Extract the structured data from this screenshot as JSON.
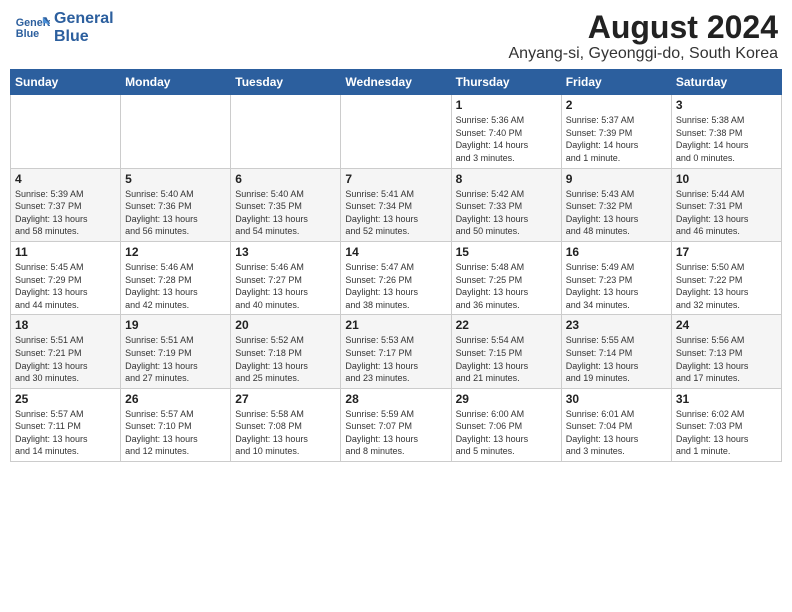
{
  "logo": {
    "line1": "General",
    "line2": "Blue"
  },
  "title": "August 2024",
  "subtitle": "Anyang-si, Gyeonggi-do, South Korea",
  "days_of_week": [
    "Sunday",
    "Monday",
    "Tuesday",
    "Wednesday",
    "Thursday",
    "Friday",
    "Saturday"
  ],
  "weeks": [
    [
      {
        "day": "",
        "info": ""
      },
      {
        "day": "",
        "info": ""
      },
      {
        "day": "",
        "info": ""
      },
      {
        "day": "",
        "info": ""
      },
      {
        "day": "1",
        "info": "Sunrise: 5:36 AM\nSunset: 7:40 PM\nDaylight: 14 hours\nand 3 minutes."
      },
      {
        "day": "2",
        "info": "Sunrise: 5:37 AM\nSunset: 7:39 PM\nDaylight: 14 hours\nand 1 minute."
      },
      {
        "day": "3",
        "info": "Sunrise: 5:38 AM\nSunset: 7:38 PM\nDaylight: 14 hours\nand 0 minutes."
      }
    ],
    [
      {
        "day": "4",
        "info": "Sunrise: 5:39 AM\nSunset: 7:37 PM\nDaylight: 13 hours\nand 58 minutes."
      },
      {
        "day": "5",
        "info": "Sunrise: 5:40 AM\nSunset: 7:36 PM\nDaylight: 13 hours\nand 56 minutes."
      },
      {
        "day": "6",
        "info": "Sunrise: 5:40 AM\nSunset: 7:35 PM\nDaylight: 13 hours\nand 54 minutes."
      },
      {
        "day": "7",
        "info": "Sunrise: 5:41 AM\nSunset: 7:34 PM\nDaylight: 13 hours\nand 52 minutes."
      },
      {
        "day": "8",
        "info": "Sunrise: 5:42 AM\nSunset: 7:33 PM\nDaylight: 13 hours\nand 50 minutes."
      },
      {
        "day": "9",
        "info": "Sunrise: 5:43 AM\nSunset: 7:32 PM\nDaylight: 13 hours\nand 48 minutes."
      },
      {
        "day": "10",
        "info": "Sunrise: 5:44 AM\nSunset: 7:31 PM\nDaylight: 13 hours\nand 46 minutes."
      }
    ],
    [
      {
        "day": "11",
        "info": "Sunrise: 5:45 AM\nSunset: 7:29 PM\nDaylight: 13 hours\nand 44 minutes."
      },
      {
        "day": "12",
        "info": "Sunrise: 5:46 AM\nSunset: 7:28 PM\nDaylight: 13 hours\nand 42 minutes."
      },
      {
        "day": "13",
        "info": "Sunrise: 5:46 AM\nSunset: 7:27 PM\nDaylight: 13 hours\nand 40 minutes."
      },
      {
        "day": "14",
        "info": "Sunrise: 5:47 AM\nSunset: 7:26 PM\nDaylight: 13 hours\nand 38 minutes."
      },
      {
        "day": "15",
        "info": "Sunrise: 5:48 AM\nSunset: 7:25 PM\nDaylight: 13 hours\nand 36 minutes."
      },
      {
        "day": "16",
        "info": "Sunrise: 5:49 AM\nSunset: 7:23 PM\nDaylight: 13 hours\nand 34 minutes."
      },
      {
        "day": "17",
        "info": "Sunrise: 5:50 AM\nSunset: 7:22 PM\nDaylight: 13 hours\nand 32 minutes."
      }
    ],
    [
      {
        "day": "18",
        "info": "Sunrise: 5:51 AM\nSunset: 7:21 PM\nDaylight: 13 hours\nand 30 minutes."
      },
      {
        "day": "19",
        "info": "Sunrise: 5:51 AM\nSunset: 7:19 PM\nDaylight: 13 hours\nand 27 minutes."
      },
      {
        "day": "20",
        "info": "Sunrise: 5:52 AM\nSunset: 7:18 PM\nDaylight: 13 hours\nand 25 minutes."
      },
      {
        "day": "21",
        "info": "Sunrise: 5:53 AM\nSunset: 7:17 PM\nDaylight: 13 hours\nand 23 minutes."
      },
      {
        "day": "22",
        "info": "Sunrise: 5:54 AM\nSunset: 7:15 PM\nDaylight: 13 hours\nand 21 minutes."
      },
      {
        "day": "23",
        "info": "Sunrise: 5:55 AM\nSunset: 7:14 PM\nDaylight: 13 hours\nand 19 minutes."
      },
      {
        "day": "24",
        "info": "Sunrise: 5:56 AM\nSunset: 7:13 PM\nDaylight: 13 hours\nand 17 minutes."
      }
    ],
    [
      {
        "day": "25",
        "info": "Sunrise: 5:57 AM\nSunset: 7:11 PM\nDaylight: 13 hours\nand 14 minutes."
      },
      {
        "day": "26",
        "info": "Sunrise: 5:57 AM\nSunset: 7:10 PM\nDaylight: 13 hours\nand 12 minutes."
      },
      {
        "day": "27",
        "info": "Sunrise: 5:58 AM\nSunset: 7:08 PM\nDaylight: 13 hours\nand 10 minutes."
      },
      {
        "day": "28",
        "info": "Sunrise: 5:59 AM\nSunset: 7:07 PM\nDaylight: 13 hours\nand 8 minutes."
      },
      {
        "day": "29",
        "info": "Sunrise: 6:00 AM\nSunset: 7:06 PM\nDaylight: 13 hours\nand 5 minutes."
      },
      {
        "day": "30",
        "info": "Sunrise: 6:01 AM\nSunset: 7:04 PM\nDaylight: 13 hours\nand 3 minutes."
      },
      {
        "day": "31",
        "info": "Sunrise: 6:02 AM\nSunset: 7:03 PM\nDaylight: 13 hours\nand 1 minute."
      }
    ]
  ]
}
